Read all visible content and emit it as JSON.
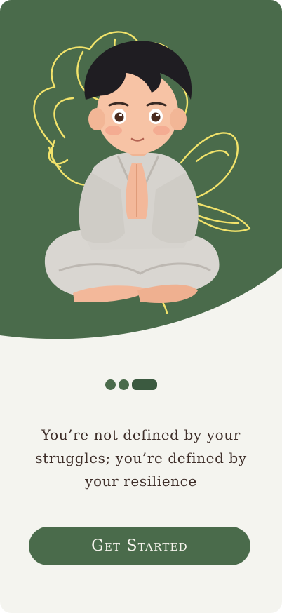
{
  "onboarding": {
    "quote": "You’re not defined by your struggles; you’re defined by your resilience",
    "cta_label": "Get Started",
    "pager": {
      "total": 3,
      "active_index": 2
    }
  },
  "theme": {
    "primary": "#4a6b4b",
    "background": "#f4f4ef",
    "accent_yellow": "#f2e36b",
    "text": "#3f2f2a"
  }
}
